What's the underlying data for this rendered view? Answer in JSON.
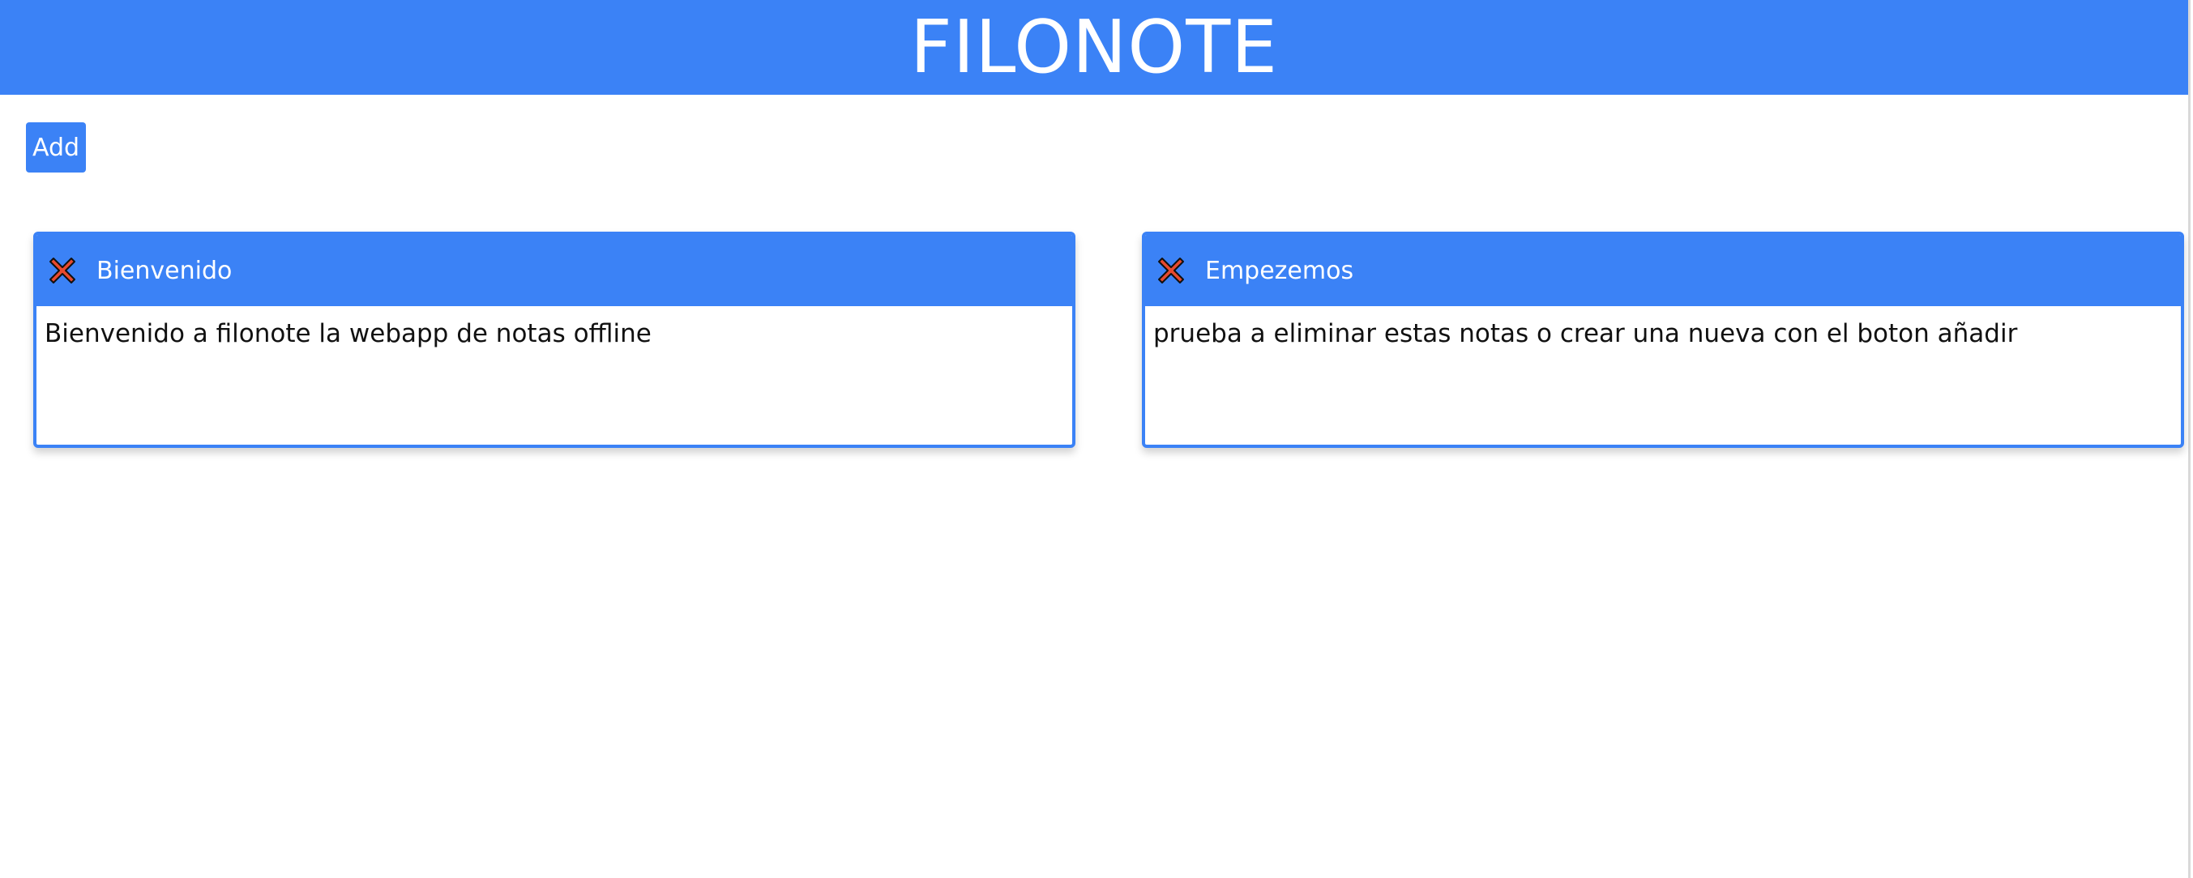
{
  "header": {
    "title": "FILONOTE"
  },
  "toolbar": {
    "add_label": "Add"
  },
  "notes": [
    {
      "title": "Bienvenido",
      "body": "Bienvenido a filonote la webapp de notas offline"
    },
    {
      "title": "Empezemos",
      "body": "prueba a eliminar estas notas o crear una nueva con el boton añadir"
    }
  ],
  "icons": {
    "delete": "close-icon"
  },
  "colors": {
    "accent": "#3b82f6",
    "delete_icon": "#e84a2e"
  }
}
